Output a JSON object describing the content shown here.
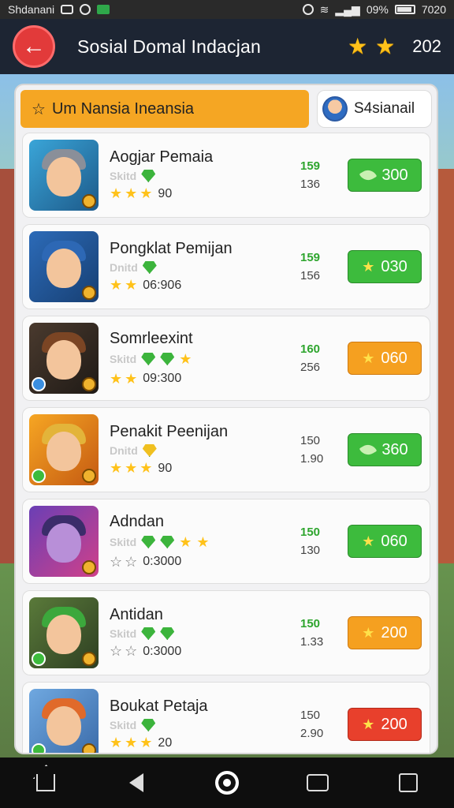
{
  "status_bar": {
    "left_text": "Shdanani",
    "right_text": "09%",
    "time": "7020"
  },
  "header": {
    "title": "Sosial Domal Indacjan",
    "count": "202"
  },
  "tabs": {
    "active_label": "Um Nansia  Ineansia",
    "user_label": "S4sianail"
  },
  "rows": [
    {
      "name": "Aogjar Pemaia",
      "sub": "Skitd",
      "rating_text": "90",
      "num_top": "159",
      "num_bot": "136",
      "button": "300",
      "button_color": "green",
      "button_icon": "leaf-icon"
    },
    {
      "name": "Pongklat Pemijan",
      "sub": "Dnitd",
      "rating_text": "06:906",
      "num_top": "159",
      "num_bot": "156",
      "button": "030",
      "button_color": "green",
      "button_icon": "star-icon"
    },
    {
      "name": "Somrleexint",
      "sub": "Skitd",
      "rating_text": "09:300",
      "num_top": "160",
      "num_bot": "256",
      "button": "060",
      "button_color": "orange",
      "button_icon": "star-icon"
    },
    {
      "name": "Penakit Peenijan",
      "sub": "Dnitd",
      "rating_text": "90",
      "num_top": "150",
      "num_bot": "1.90",
      "button": "360",
      "button_color": "green",
      "button_icon": "leaf-icon"
    },
    {
      "name": "Adndan",
      "sub": "Skitd",
      "rating_text": "0:3000",
      "num_top": "150",
      "num_bot": "130",
      "button": "060",
      "button_color": "green",
      "button_icon": "star-icon"
    },
    {
      "name": "Antidan",
      "sub": "Skitd",
      "rating_text": "0:3000",
      "num_top": "150",
      "num_bot": "1.33",
      "button": "200",
      "button_color": "orange",
      "button_icon": "star-icon"
    },
    {
      "name": "Boukat Petaja",
      "sub": "Skitd",
      "rating_text": "20",
      "num_top": "150",
      "num_bot": "2.90",
      "button": "200",
      "button_color": "red",
      "button_icon": "star-icon"
    }
  ],
  "colors": {
    "accent_orange": "#f5a623",
    "green": "#3dbb3d",
    "red": "#e8402c",
    "header_bg": "#1d2533"
  }
}
